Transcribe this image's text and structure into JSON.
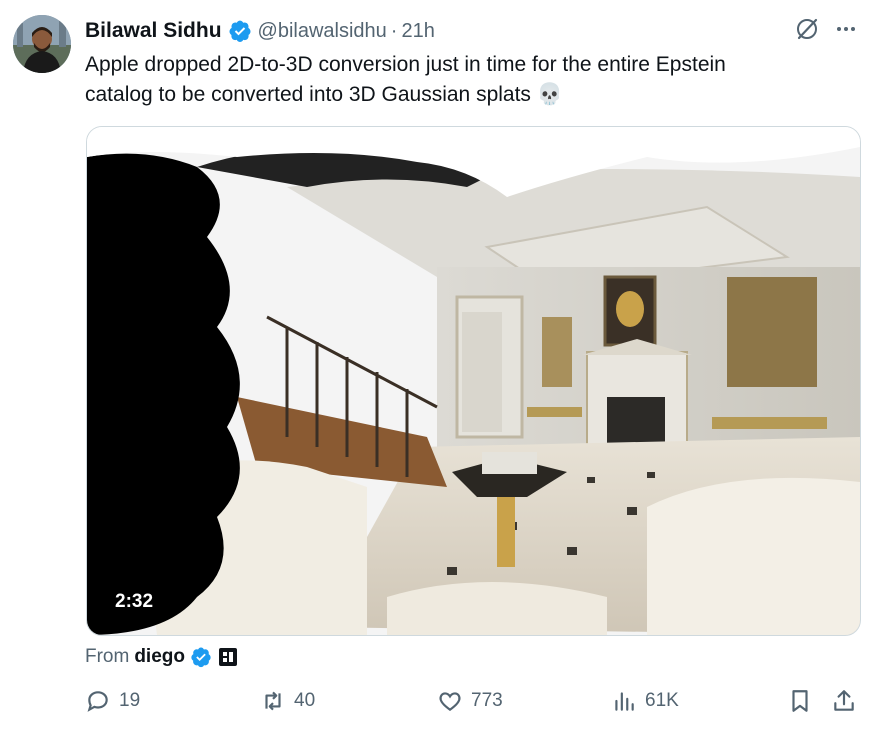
{
  "tweet": {
    "author_name": "Bilawal Sidhu",
    "handle": "@bilawalsidhu",
    "separator": "·",
    "time": "21h",
    "text": "Apple dropped 2D-to-3D conversion just in time for the entire Epstein\ncatalog to be converted into 3D Gaussian splats 💀",
    "video_duration": "2:32",
    "from_label": "From",
    "from_author": "diego"
  },
  "actions": {
    "replies": "19",
    "reposts": "40",
    "likes": "773",
    "views": "61K"
  },
  "colors": {
    "verified": "#1d9bf0",
    "secondary_text": "#536471"
  },
  "icons": [
    "verified-badge-icon",
    "grok-icon",
    "more-icon",
    "reply-icon",
    "repost-icon",
    "like-icon",
    "views-icon",
    "bookmark-icon",
    "share-icon",
    "square-badge-icon"
  ]
}
